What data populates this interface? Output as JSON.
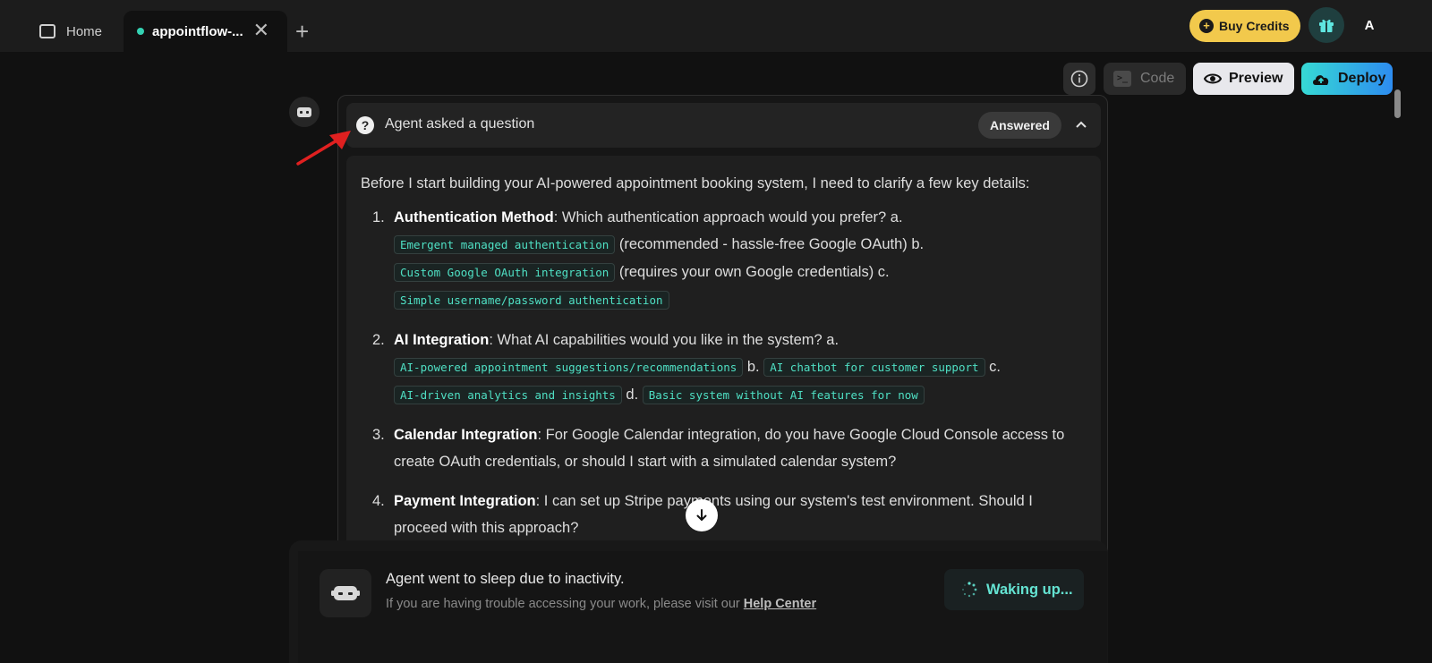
{
  "tabs": {
    "home_label": "Home",
    "active_label": "appointflow-...",
    "close_glyph": "✕",
    "new_tab_glyph": "+"
  },
  "header": {
    "buy_credits_label": "Buy Credits",
    "avatar_initial": "A"
  },
  "toolbar": {
    "code_label": "Code",
    "preview_label": "Preview",
    "deploy_label": "Deploy"
  },
  "question": {
    "title": "Agent asked a question",
    "status": "Answered",
    "intro": "Before I start building your AI-powered appointment booking system, I need to clarify a few key details:",
    "items": [
      {
        "num": "1.",
        "heading": "Authentication Method",
        "text": ": Which authentication approach would you prefer? a.",
        "code_a": "Emergent managed authentication",
        "after_a": " (recommended - hassle-free Google OAuth) b.",
        "code_b": "Custom Google OAuth integration",
        "after_b": " (requires your own Google credentials) c.",
        "code_c": "Simple username/password authentication"
      },
      {
        "num": "2.",
        "heading": "AI Integration",
        "text": ": What AI capabilities would you like in the system? a.",
        "code_a": "AI-powered appointment suggestions/recommendations",
        "after_a": " b. ",
        "code_b": "AI chatbot for customer support",
        "after_b": " c.",
        "code_c": "AI-driven analytics and insights",
        "after_c": " d. ",
        "code_d": "Basic system without AI features for now"
      },
      {
        "num": "3.",
        "heading": "Calendar Integration",
        "text": ": For Google Calendar integration, do you have Google Cloud Console access to create OAuth credentials, or should I start with a simulated calendar system?"
      },
      {
        "num": "4.",
        "heading": "Payment Integration",
        "text": ": I can set up Stripe payments using our system's test environment. Should I proceed with this approach?"
      }
    ]
  },
  "sleep": {
    "title": "Agent went to sleep due to inactivity.",
    "subtitle": "If you are having trouble accessing your work, please visit our ",
    "help_link": "Help Center",
    "wake_label": "Waking up..."
  },
  "colors": {
    "accent_teal": "#34d2b3",
    "buy_credits_bg": "#f2c94c",
    "annotation_red": "#e02020"
  },
  "icons": [
    "home-icon",
    "close-icon",
    "plus-icon",
    "coin-icon",
    "gift-icon",
    "info-icon",
    "terminal-icon",
    "eye-icon",
    "cloud-upload-icon",
    "robot-icon",
    "question-icon",
    "chevron-up-icon",
    "arrow-down-icon",
    "spinner-icon"
  ]
}
